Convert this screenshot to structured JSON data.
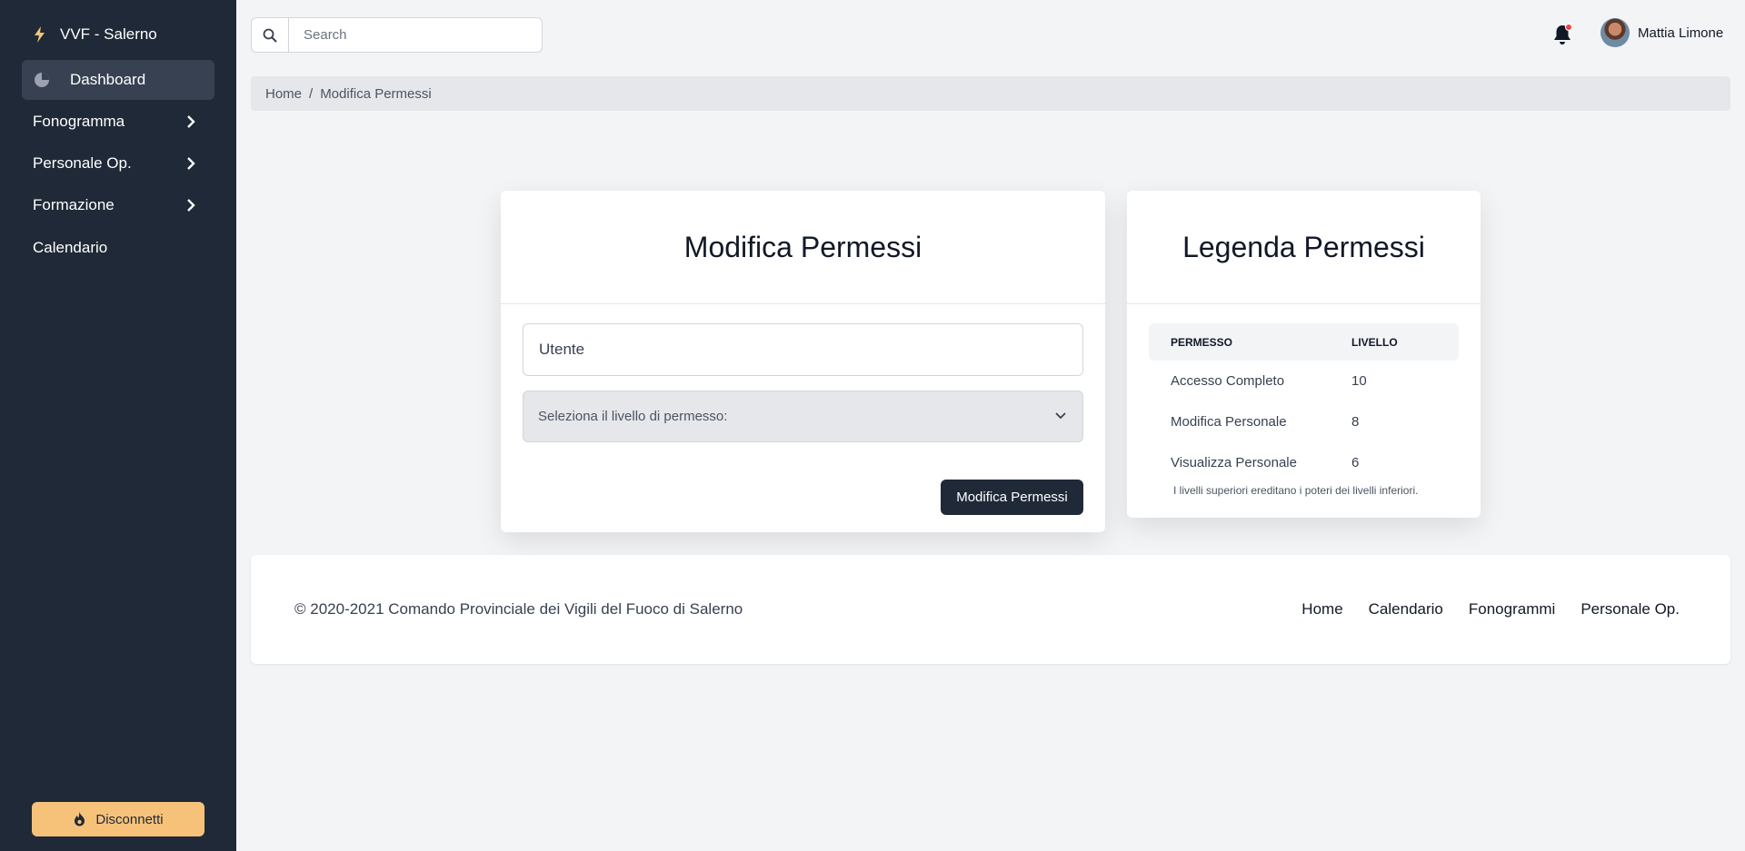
{
  "sidebar": {
    "brand": "VVF - Salerno",
    "items": [
      {
        "label": "Dashboard"
      },
      {
        "label": "Fonogramma"
      },
      {
        "label": "Personale Op."
      },
      {
        "label": "Formazione"
      },
      {
        "label": "Calendario"
      }
    ],
    "logout_label": "Disconnetti",
    "logout_color": "#f6c27a",
    "bg_color": "#1f2937"
  },
  "topbar": {
    "search_placeholder": "Search",
    "user_name": "Mattia Limone",
    "notification_dot_color": "#ef4444"
  },
  "breadcrumb": {
    "home": "Home",
    "separator": "/",
    "current": "Modifica Permessi"
  },
  "main_card": {
    "title": "Modifica Permessi",
    "user_placeholder": "Utente",
    "select_label": "Seleziona il livello di permesso:",
    "submit_label": "Modifica Permessi"
  },
  "legend_card": {
    "title": "Legenda Permessi",
    "headers": [
      "PERMESSO",
      "LIVELLO"
    ],
    "rows": [
      {
        "permesso": "Accesso Completo",
        "livello": "10"
      },
      {
        "permesso": "Modifica Personale",
        "livello": "8"
      },
      {
        "permesso": "Visualizza Personale",
        "livello": "6"
      }
    ],
    "note": "I livelli superiori ereditano i poteri dei livelli inferiori."
  },
  "footer": {
    "copyright": "© 2020-2021 Comando Provinciale dei Vigili del Fuoco di Salerno",
    "links": [
      "Home",
      "Calendario",
      "Fonogrammi",
      "Personale Op."
    ]
  }
}
